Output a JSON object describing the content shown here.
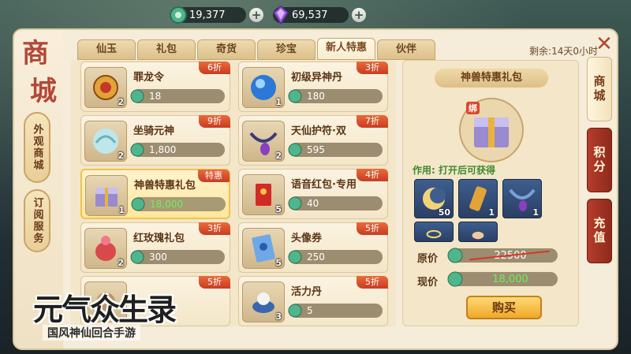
{
  "currency": {
    "jade": {
      "icon": "jade-coin-icon",
      "value": "19,377"
    },
    "crystal": {
      "icon": "purple-crystal-icon",
      "value": "69,537"
    }
  },
  "shop": {
    "title_chars": [
      "商",
      "城"
    ],
    "side_buttons": [
      "外观商城",
      "订阅服务"
    ],
    "tabs": [
      "仙玉",
      "礼包",
      "奇货",
      "珍宝",
      "新人特惠",
      "伙伴"
    ],
    "active_tab": "新人特惠",
    "remaining": "剩余:14天0小时"
  },
  "items": [
    {
      "name": "罪龙令",
      "tag": "6折",
      "price": "18",
      "count": "2",
      "icon": "dragon-token-icon"
    },
    {
      "name": "初级异神丹",
      "tag": "3折",
      "price": "180",
      "count": "1",
      "icon": "blue-orb-icon"
    },
    {
      "name": "坐骑元神",
      "tag": "9折",
      "price": "1,800",
      "count": "2",
      "icon": "mount-spirit-icon"
    },
    {
      "name": "天仙护符·双",
      "tag": "7折",
      "price": "595",
      "count": "2",
      "icon": "amulet-icon"
    },
    {
      "name": "神兽特惠礼包",
      "tag": "特惠",
      "price": "18,000",
      "count": "1",
      "icon": "gift-chest-icon",
      "selected": true
    },
    {
      "name": "语音红包·专用",
      "tag": "4折",
      "price": "40",
      "count": "5",
      "icon": "red-envelope-icon"
    },
    {
      "name": "红玫瑰礼包",
      "tag": "3折",
      "price": "300",
      "count": "2",
      "icon": "rose-bag-icon"
    },
    {
      "name": "头像券",
      "tag": "5折",
      "price": "250",
      "count": "5",
      "icon": "avatar-ticket-icon"
    },
    {
      "name": "",
      "tag": "5折",
      "price": "",
      "count": "",
      "icon": "partial-item-icon"
    },
    {
      "name": "活力丹",
      "tag": "5折",
      "price": "5",
      "count": "3",
      "icon": "vitality-pill-icon"
    }
  ],
  "detail": {
    "title": "神兽特惠礼包",
    "bind_tag": "绑",
    "use_text": "作用: 打开后可获得",
    "contents": [
      {
        "icon": "moon-charm-icon",
        "count": "50"
      },
      {
        "icon": "golden-scroll-icon",
        "count": "1"
      },
      {
        "icon": "ribbon-amulet-icon",
        "count": "1"
      },
      {
        "icon": "halo-ring-icon",
        "count": ""
      },
      {
        "icon": "beast-figure-icon",
        "count": ""
      }
    ],
    "original_label": "原价",
    "original_price": "22500",
    "current_label": "现价",
    "current_price": "18,000",
    "buy_label": "购买"
  },
  "side_tabs": [
    "商城",
    "积分",
    "充值"
  ],
  "logo": {
    "title": "元气众生录",
    "subtitle": "国风神仙回合手游"
  },
  "colors": {
    "accent_red": "#b43d2b",
    "price_green": "#6cf05a",
    "tag_orange": "#e86b3a"
  }
}
